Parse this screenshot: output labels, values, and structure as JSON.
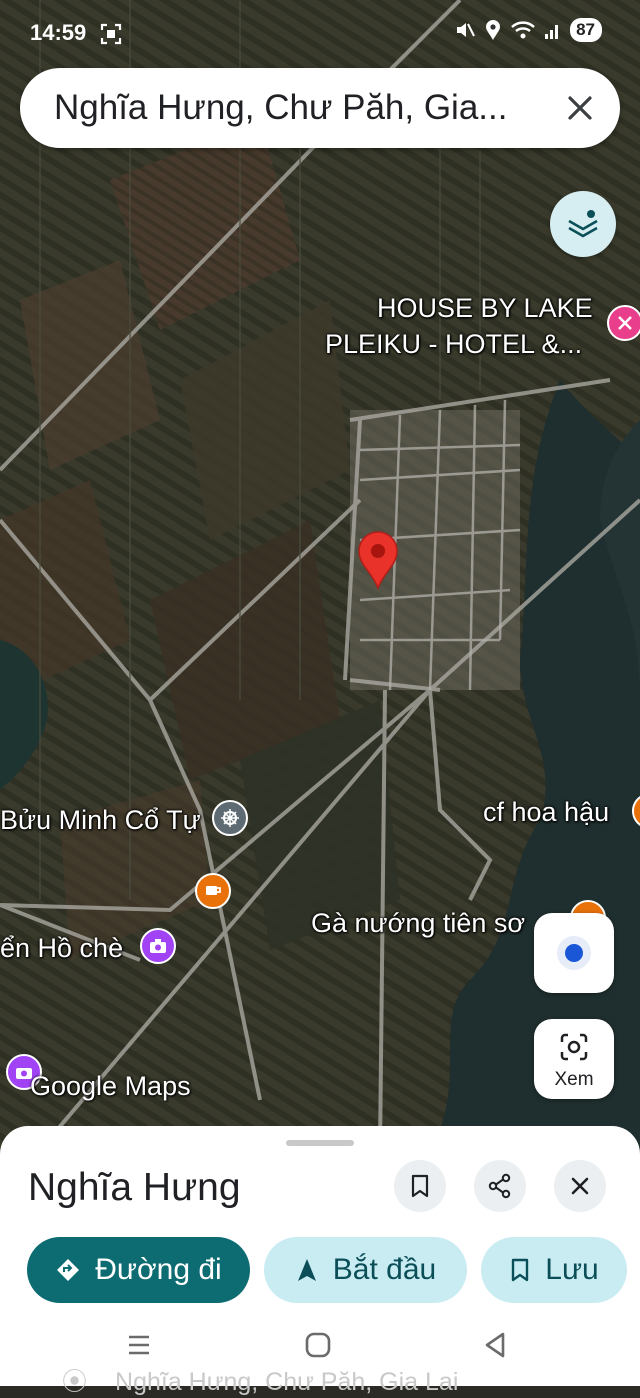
{
  "status_bar": {
    "time": "14:59",
    "battery": "87"
  },
  "search": {
    "query": "Nghĩa Hưng, Chư Păh, Gia..."
  },
  "map": {
    "labels": {
      "hotel_line1": "HOUSE BY LAKE",
      "hotel_line2": "PLEIKU - HOTEL &...",
      "temple": "Bửu Minh Cổ Tự",
      "cafe": "cf hoa hậu",
      "restaurant": "Gà nướng tiên sơ",
      "viewpoint": "ển Hồ chè"
    },
    "attribution": "Google Maps",
    "colors": {
      "pin": "#e8322a",
      "hotel_poi": "#e83e8c",
      "food_poi": "#e8710a",
      "attraction_poi": "#a142f4",
      "temple_poi": "#5f6b73"
    }
  },
  "controls": {
    "lens_label": "Xem"
  },
  "place": {
    "title": "Nghĩa Hưng",
    "directions": "Đường đi",
    "start": "Bắt đầu",
    "save": "Lưu",
    "peek_address": "Nghĩa Hưng, Chư Păh, Gia Lai"
  },
  "icons": [
    "screenshot-icon",
    "mute-icon",
    "location-status-icon",
    "wifi-icon",
    "signal-icon",
    "battery-icon",
    "close-icon",
    "layers-icon",
    "map-pin-icon",
    "hotel-icon",
    "temple-icon",
    "cafe-icon",
    "camera-icon",
    "my-location-icon",
    "lens-icon",
    "bookmark-icon",
    "share-icon",
    "directions-icon",
    "navigation-icon",
    "recents-icon",
    "home-icon",
    "back-icon"
  ]
}
